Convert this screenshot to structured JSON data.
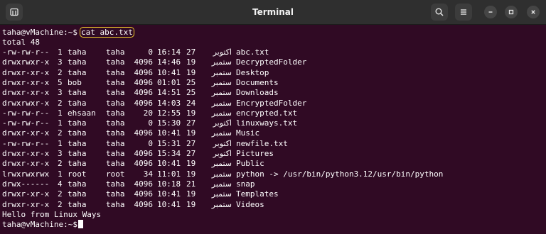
{
  "window": {
    "title": "Terminal"
  },
  "prompt": "taha@vMachine:~$",
  "command": "cat abc.txt",
  "total": "total 48",
  "listing": [
    {
      "perms": "-rw-rw-r--",
      "links": "1",
      "owner": "taha",
      "group": "taha",
      "size": "0",
      "time": "16:14",
      "day": "27",
      "month": "اکتوبر",
      "name": "abc.txt"
    },
    {
      "perms": "drwxrwxr-x",
      "links": "3",
      "owner": "taha",
      "group": "taha",
      "size": "4096",
      "time": "14:46",
      "day": "19",
      "month": "ستمبر",
      "name": "DecryptedFolder"
    },
    {
      "perms": "drwxr-xr-x",
      "links": "2",
      "owner": "taha",
      "group": "taha",
      "size": "4096",
      "time": "10:41",
      "day": "19",
      "month": "ستمبر",
      "name": "Desktop"
    },
    {
      "perms": "drwxr-xr-x",
      "links": "5",
      "owner": "bob",
      "group": "taha",
      "size": "4096",
      "time": "01:01",
      "day": "25",
      "month": "ستمبر",
      "name": "Documents"
    },
    {
      "perms": "drwxr-xr-x",
      "links": "3",
      "owner": "taha",
      "group": "taha",
      "size": "4096",
      "time": "14:51",
      "day": "25",
      "month": "ستمبر",
      "name": "Downloads"
    },
    {
      "perms": "drwxrwxr-x",
      "links": "2",
      "owner": "taha",
      "group": "taha",
      "size": "4096",
      "time": "14:03",
      "day": "24",
      "month": "ستمبر",
      "name": "EncryptedFolder"
    },
    {
      "perms": "-rw-rw-r--",
      "links": "1",
      "owner": "ehsaan",
      "group": "taha",
      "size": "20",
      "time": "12:55",
      "day": "19",
      "month": "ستمبر",
      "name": "encrypted.txt"
    },
    {
      "perms": "-rw-rw-r--",
      "links": "1",
      "owner": "taha",
      "group": "taha",
      "size": "0",
      "time": "15:30",
      "day": "27",
      "month": "اکتوبر",
      "name": "linuxways.txt"
    },
    {
      "perms": "drwxr-xr-x",
      "links": "2",
      "owner": "taha",
      "group": "taha",
      "size": "4096",
      "time": "10:41",
      "day": "19",
      "month": "ستمبر",
      "name": "Music"
    },
    {
      "perms": "-rw-rw-r--",
      "links": "1",
      "owner": "taha",
      "group": "taha",
      "size": "0",
      "time": "15:31",
      "day": "27",
      "month": "اکتوبر",
      "name": "newfile.txt"
    },
    {
      "perms": "drwxr-xr-x",
      "links": "3",
      "owner": "taha",
      "group": "taha",
      "size": "4096",
      "time": "15:34",
      "day": "27",
      "month": "اکتوبر",
      "name": "Pictures"
    },
    {
      "perms": "drwxr-xr-x",
      "links": "2",
      "owner": "taha",
      "group": "taha",
      "size": "4096",
      "time": "10:41",
      "day": "19",
      "month": "ستمبر",
      "name": "Public"
    },
    {
      "perms": "lrwxrwxrwx",
      "links": "1",
      "owner": "root",
      "group": "root",
      "size": "34",
      "time": "11:01",
      "day": "19",
      "month": "ستمبر",
      "name": "python -> /usr/bin/python3.12/usr/bin/python"
    },
    {
      "perms": "drwx------",
      "links": "4",
      "owner": "taha",
      "group": "taha",
      "size": "4096",
      "time": "10:18",
      "day": "21",
      "month": "ستمبر",
      "name": "snap"
    },
    {
      "perms": "drwxr-xr-x",
      "links": "2",
      "owner": "taha",
      "group": "taha",
      "size": "4096",
      "time": "10:41",
      "day": "19",
      "month": "ستمبر",
      "name": "Templates"
    },
    {
      "perms": "drwxr-xr-x",
      "links": "2",
      "owner": "taha",
      "group": "taha",
      "size": "4096",
      "time": "10:41",
      "day": "19",
      "month": "ستمبر",
      "name": "Videos"
    }
  ],
  "output": "Hello from Linux Ways",
  "icons": {
    "new_tab": "new-tab-icon",
    "search": "search-icon",
    "menu": "hamburger-menu-icon",
    "minimize": "minimize-icon",
    "maximize": "maximize-icon",
    "close": "close-icon"
  },
  "colors": {
    "terminal_bg": "#300a24",
    "titlebar_bg": "#2f2f2f",
    "text": "#ffffff",
    "highlight": "#e8c52a"
  }
}
